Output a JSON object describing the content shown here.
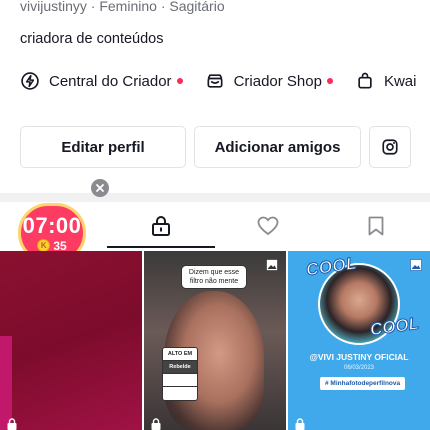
{
  "profile": {
    "meta_line": "vivijustinyy · Feminino · Sagitário",
    "bio": "criadora de conteúdos"
  },
  "shortcuts": [
    {
      "label": "Central do Criador",
      "icon": "bolt-icon",
      "has_dot": true
    },
    {
      "label": "Criador Shop",
      "icon": "shop-icon",
      "has_dot": true
    },
    {
      "label": "Kwai",
      "icon": "bag-icon",
      "has_dot": false
    }
  ],
  "buttons": {
    "edit_profile": "Editar perfil",
    "add_friends": "Adicionar amigos",
    "instagram_icon": "instagram-icon"
  },
  "tabs": [
    {
      "name": "private",
      "icon": "lock-icon",
      "active": true
    },
    {
      "name": "liked",
      "icon": "heart-icon",
      "active": false
    },
    {
      "name": "saved",
      "icon": "bookmark-icon",
      "active": false
    }
  ],
  "timer": {
    "time": "07:00",
    "coins": "35",
    "coin_letter": "K"
  },
  "grid": {
    "cell2": {
      "speech": "Dizem que esse filtro não mente",
      "filter_rows": [
        "ALTO EM",
        "Rebelde",
        "",
        ""
      ]
    },
    "cell3": {
      "cool_text": "COOL",
      "name": "@VIVI JUSTINY OFICIAL",
      "date": "06/03/2023",
      "hashtag": "# Minhafotodeperfilnova"
    }
  },
  "colors": {
    "accent": "#fe2c55",
    "text": "#161823",
    "muted": "#6b6d75",
    "border": "#e3e3e4",
    "timer_bg": "#fe3b63",
    "timer_ring": "#ffd36b",
    "cell3_bg": "#3fa9ec"
  }
}
